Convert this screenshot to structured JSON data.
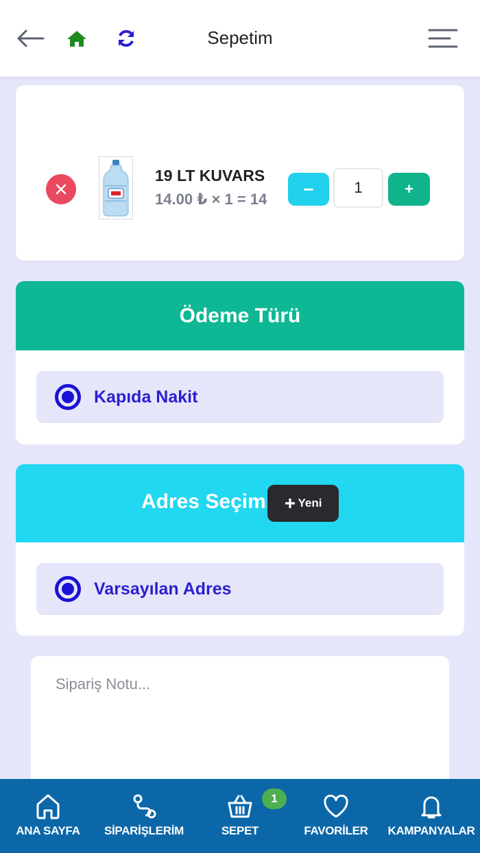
{
  "header": {
    "title": "Sepetim",
    "icons": {
      "back": "arrow-left-icon",
      "home": "home-icon",
      "refresh": "refresh-icon",
      "menu": "menu-icon"
    }
  },
  "cart": {
    "items": [
      {
        "name": "19 LT KUVARS",
        "price_line": "14.00 ₺ × 1 = 14",
        "quantity": "1",
        "minus_label": "−",
        "plus_label": "+"
      }
    ]
  },
  "payment": {
    "title": "Ödeme Türü",
    "options": [
      {
        "label": "Kapıda Nakit",
        "selected": true
      }
    ]
  },
  "address": {
    "title": "Adres Seçimi",
    "new_button": "Yeni",
    "options": [
      {
        "label": "Varsayılan Adres",
        "selected": true
      }
    ]
  },
  "note": {
    "placeholder": "Sipariş Notu..."
  },
  "bottom_nav": {
    "items": [
      {
        "label": "ANA SAYFA",
        "icon": "home-outline-icon"
      },
      {
        "label": "SİPARİŞLERİM",
        "icon": "route-icon"
      },
      {
        "label": "SEPET",
        "icon": "basket-icon"
      },
      {
        "label": "FAVORİLER",
        "icon": "heart-icon"
      },
      {
        "label": "KAMPANYALAR",
        "icon": "bell-icon"
      }
    ],
    "cart_badge": "1"
  },
  "colors": {
    "background": "#e6e6fb",
    "payment_header": "#0eb894",
    "address_header": "#22d7f0",
    "radio": "#1b12d6",
    "remove": "#ea4a5f",
    "minus": "#22d1ee",
    "plus": "#0fb38c",
    "nav": "#0b67a8",
    "badge": "#4caf50"
  }
}
